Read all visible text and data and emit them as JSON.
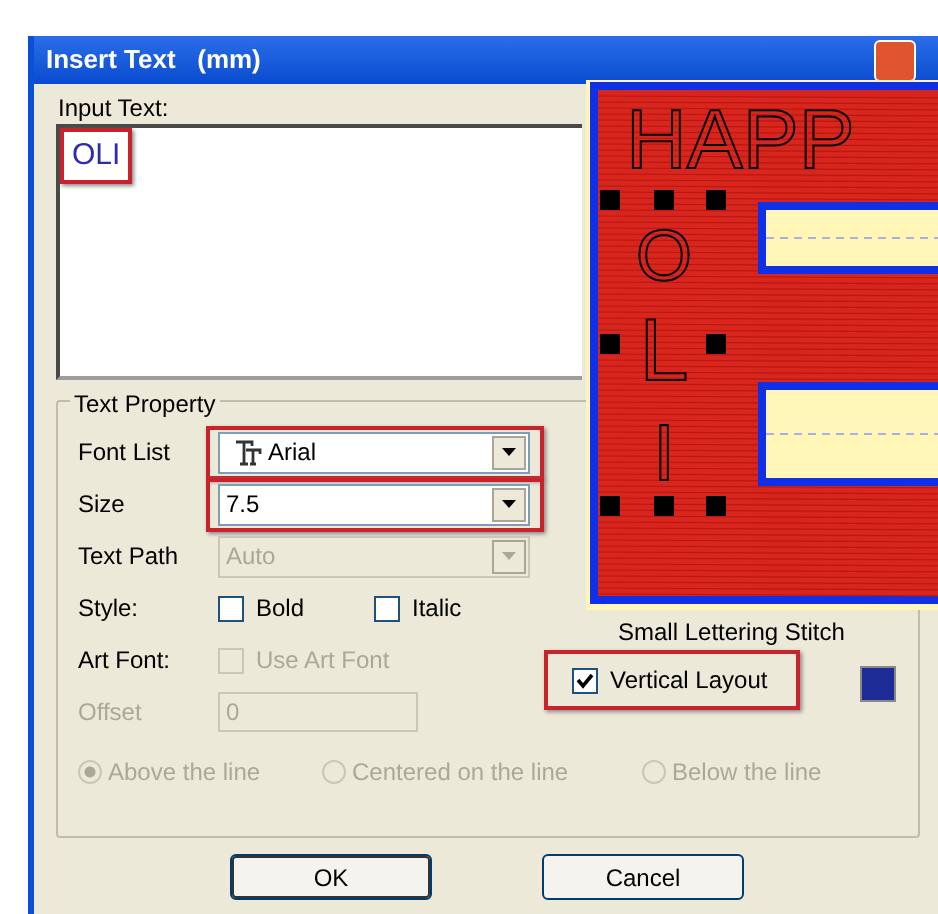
{
  "window": {
    "title": "Insert Text   (mm)"
  },
  "input_text": {
    "label": "Input Text:",
    "value": "OLI",
    "highlighted": true
  },
  "text_property": {
    "title": "Text Property",
    "fields": [
      {
        "label": "Font List",
        "value": "Arial",
        "kind": "font",
        "disabled": false,
        "highlighted": true
      },
      {
        "label": "Size",
        "value": "7.5",
        "kind": "combo",
        "disabled": false,
        "highlighted": true
      },
      {
        "label": "Text Path",
        "value": "Auto",
        "kind": "combo",
        "disabled": true,
        "highlighted": false
      }
    ],
    "style": {
      "label": "Style:",
      "options": [
        {
          "label": "Bold",
          "checked": false
        },
        {
          "label": "Italic",
          "checked": false
        }
      ]
    },
    "art_font": {
      "label": "Art Font:",
      "option": {
        "label": "Use Art Font",
        "checked": false,
        "disabled": true
      }
    },
    "offset": {
      "label": "Offset",
      "value": "0",
      "disabled": true
    },
    "positions": [
      {
        "label": "Above the line",
        "selected": true,
        "disabled": true
      },
      {
        "label": "Centered on the line",
        "selected": false,
        "disabled": true
      },
      {
        "label": "Below the line",
        "selected": false,
        "disabled": true
      }
    ],
    "small_lettering": {
      "label": "Small Lettering Stitch"
    },
    "vertical_layout": {
      "label": "Vertical Layout",
      "checked": true,
      "highlighted": true
    },
    "color_swatch": {
      "color": "#1c2b96"
    }
  },
  "buttons": [
    {
      "label": "OK",
      "default": true
    },
    {
      "label": "Cancel",
      "default": false
    }
  ],
  "preview": {
    "headline": "HAPP",
    "letters": [
      "O",
      "L",
      "I"
    ]
  }
}
